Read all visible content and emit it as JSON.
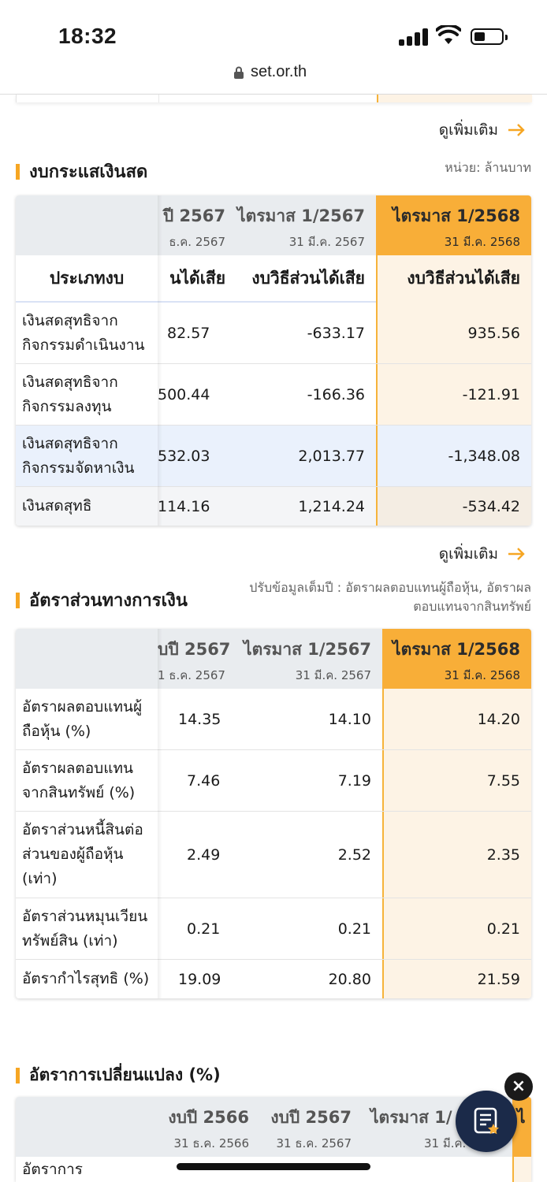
{
  "status_bar": {
    "time": "18:32"
  },
  "browser": {
    "url": "set.or.th"
  },
  "see_more_label": "ดูเพิ่มเติม",
  "cashflow": {
    "title": "งบกระแสเงินสด",
    "unit": "หน่วย: ล้านบาท",
    "columns": [
      {
        "period": "ปี 2567",
        "date": "ธ.ค. 2567"
      },
      {
        "period": "ไตรมาส 1/2567",
        "date": "31 มี.ค. 2567"
      },
      {
        "period": "ไตรมาส 1/2568",
        "date": "31 มี.ค. 2568"
      }
    ],
    "type_label": "ประเภทงบ",
    "type_values": [
      "นได้เสีย",
      "งบวิธีส่วนได้เสีย",
      "งบวิธีส่วนได้เสีย"
    ],
    "rows": [
      {
        "name": "เงินสดสุทธิจาก\nกิจกรรมดำเนินงาน",
        "values": [
          "82.57",
          "-633.17",
          "935.56"
        ]
      },
      {
        "name": "เงินสดสุทธิจาก\nกิจกรรมลงทุน",
        "values": [
          "500.44",
          "-166.36",
          "-121.91"
        ]
      },
      {
        "name": "เงินสดสุทธิจาก\nกิจกรรมจัดหาเงิน",
        "values": [
          "532.03",
          "2,013.77",
          "-1,348.08"
        ]
      },
      {
        "name": "เงินสดสุทธิ",
        "values": [
          "114.16",
          "1,214.24",
          "-534.42"
        ]
      }
    ]
  },
  "ratios": {
    "title": "อัตราส่วนทางการเงิน",
    "note": "ปรับข้อมูลเต็มปี : อัตราผลตอบแทนผู้ถือหุ้น, อัตราผลตอบแทนจากสินทรัพย์",
    "columns": [
      {
        "period": "บปี 2567",
        "date": "1 ธ.ค. 2567"
      },
      {
        "period": "ไตรมาส 1/2567",
        "date": "31 มี.ค. 2567"
      },
      {
        "period": "ไตรมาส 1/2568",
        "date": "31 มี.ค. 2568"
      }
    ],
    "rows": [
      {
        "name": "อัตราผลตอบแทนผู้\nถือหุ้น (%)",
        "values": [
          "14.35",
          "14.10",
          "14.20"
        ]
      },
      {
        "name": "อัตราผลตอบแทน\nจากสินทรัพย์ (%)",
        "values": [
          "7.46",
          "7.19",
          "7.55"
        ]
      },
      {
        "name": "อัตราส่วนหนี้สินต่อ\nส่วนของผู้ถือหุ้น\n(เท่า)",
        "values": [
          "2.49",
          "2.52",
          "2.35"
        ]
      },
      {
        "name": "อัตราส่วนหมุนเวียน\nทรัพย์สิน (เท่า)",
        "values": [
          "0.21",
          "0.21",
          "0.21"
        ]
      },
      {
        "name": "อัตรากำไรสุทธิ (%)",
        "values": [
          "19.09",
          "20.80",
          "21.59"
        ]
      }
    ]
  },
  "change": {
    "title": "อัตราการเปลี่ยนแปลง (%)",
    "columns": [
      {
        "period": "งบปี 2566",
        "date": "31 ธ.ค. 2566"
      },
      {
        "period": "งบปี 2567",
        "date": "31 ธ.ค. 2567"
      },
      {
        "period": "ไตรมาส 1/",
        "date": "31 มี.ค."
      },
      {
        "period": "ไ",
        "date": ""
      }
    ],
    "first_row": "อัตราการ"
  },
  "fab": {
    "icon": "list-star-icon",
    "close": "×"
  },
  "colors": {
    "accent": "#f8ae38",
    "highlight": "#fdf3e5",
    "header": "#e9ecef",
    "fab": "#1b2a49"
  }
}
